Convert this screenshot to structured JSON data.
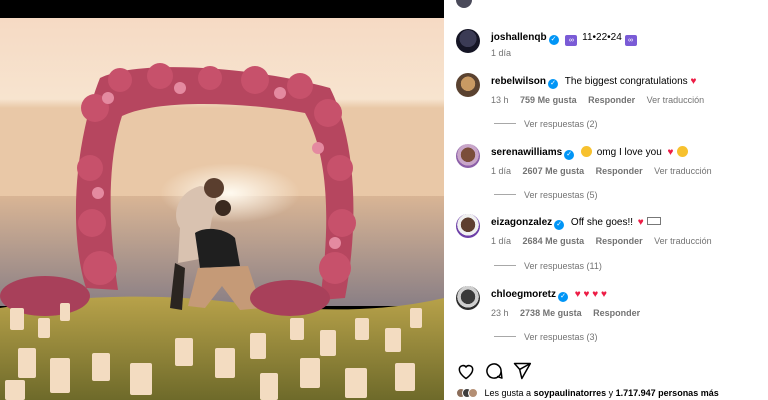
{
  "post": {
    "author": "joshallenqb",
    "caption_date": "11•22•24",
    "time": "1 día"
  },
  "comments": [
    {
      "user": "rebelwilson",
      "text": "The biggest congratulations",
      "time": "13 h",
      "likes": "759 Me gusta",
      "reply": "Responder",
      "translate": "Ver traducción",
      "replies": "Ver respuestas (2)"
    },
    {
      "user": "serenawilliams",
      "text": "omg I love you",
      "time": "1 día",
      "likes": "2607 Me gusta",
      "reply": "Responder",
      "translate": "Ver traducción",
      "replies": "Ver respuestas (5)"
    },
    {
      "user": "eizagonzalez",
      "text": "Off she goes!!",
      "time": "1 día",
      "likes": "2684 Me gusta",
      "reply": "Responder",
      "translate": "Ver traducción",
      "replies": "Ver respuestas (11)"
    },
    {
      "user": "chloegmoretz",
      "text": "",
      "time": "23 h",
      "likes": "2738 Me gusta",
      "reply": "Responder",
      "translate": "",
      "replies": "Ver respuestas (3)"
    }
  ],
  "likes_line": {
    "prefix": "Les gusta a",
    "user": "soypaulinatorres",
    "middle": "y",
    "count": "1.717.947 personas más"
  },
  "colors": {
    "verified": "#0095f6",
    "heart": "#ed1c45",
    "muted": "#737373"
  },
  "icons": [
    "heart-icon",
    "comment-icon",
    "share-icon",
    "verified-icon",
    "infinity-emoji-icon"
  ]
}
